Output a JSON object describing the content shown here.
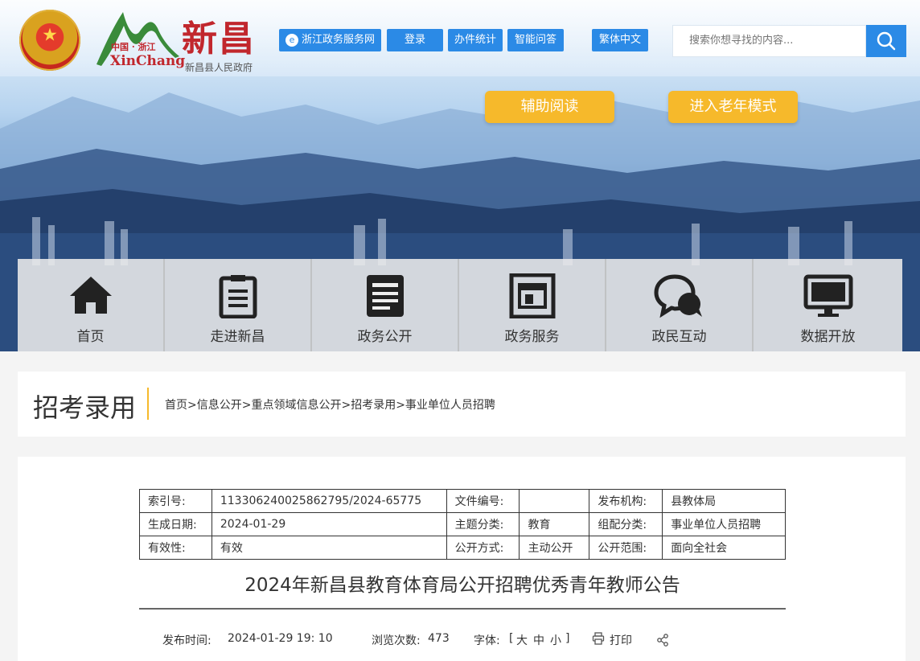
{
  "header": {
    "logo": {
      "sub": "中国 · 浙江",
      "en": "XinChang",
      "cn": "新昌",
      "gov": "新昌县人民政府"
    },
    "top_buttons": {
      "zjzw": "浙江政务服务网",
      "login": "登录",
      "stats": "办件统计",
      "qa": "智能问答",
      "trad": "繁体中文"
    },
    "search": {
      "placeholder": "搜索你想寻找的内容..."
    },
    "accessibility": {
      "assist_read": "辅助阅读",
      "elder_mode": "进入老年模式"
    }
  },
  "nav": {
    "items": [
      {
        "label": "首页",
        "icon": "home-icon"
      },
      {
        "label": "走进新昌",
        "icon": "document-list-icon"
      },
      {
        "label": "政务公开",
        "icon": "news-icon"
      },
      {
        "label": "政务服务",
        "icon": "service-window-icon"
      },
      {
        "label": "政民互动",
        "icon": "chat-bubbles-icon"
      },
      {
        "label": "数据开放",
        "icon": "monitor-icon"
      }
    ]
  },
  "section": {
    "title": "招考录用",
    "breadcrumb": "首页>信息公开>重点领域信息公开>招考录用>事业单位人员招聘"
  },
  "meta_table": {
    "rows": [
      [
        "索引号:",
        "113306240025862795/2024-65775",
        "文件编号:",
        "",
        "发布机构:",
        "县教体局"
      ],
      [
        "生成日期:",
        "2024-01-29",
        "主题分类:",
        "教育",
        "组配分类:",
        "事业单位人员招聘"
      ],
      [
        "有效性:",
        "有效",
        "公开方式:",
        "主动公开",
        "公开范围:",
        "面向全社会"
      ]
    ]
  },
  "article": {
    "title": "2024年新昌县教育体育局公开招聘优秀青年教师公告",
    "publish_time_label": "发布时间:",
    "publish_time": "2024-01-29 19: 10",
    "views_label": "浏览次数:",
    "views": "473",
    "font_label": "字体:",
    "font_open": "[",
    "font_large": "大",
    "font_medium": "中",
    "font_small": "小",
    "font_close": "]",
    "print_label": "打印"
  },
  "colors": {
    "accent_blue": "#2b8ae6",
    "accent_yellow": "#f6b92b",
    "brand_red": "#c1272d"
  }
}
